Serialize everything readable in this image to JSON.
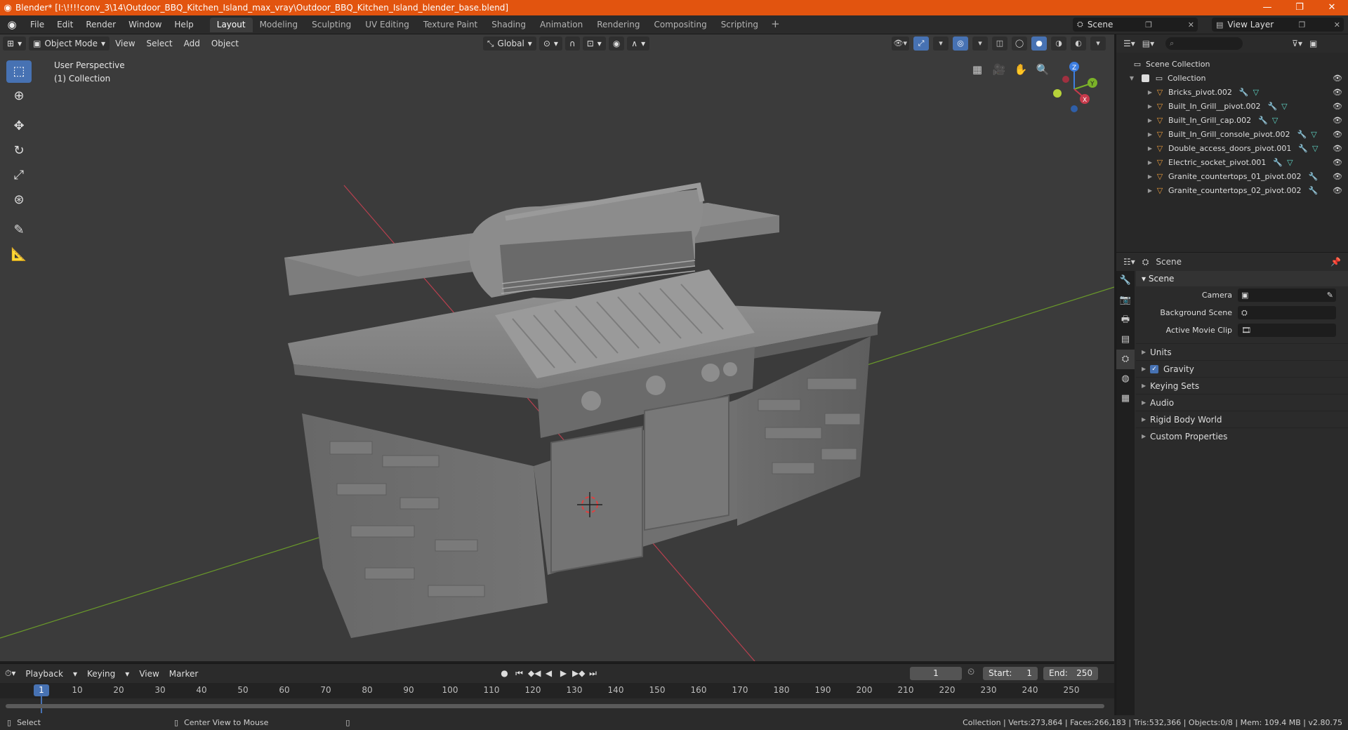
{
  "window": {
    "title": "Blender* [I:\\!!!!conv_3\\14\\Outdoor_BBQ_Kitchen_Island_max_vray\\Outdoor_BBQ_Kitchen_Island_blender_base.blend]",
    "minimize": "—",
    "maximize": "❐",
    "close": "✕"
  },
  "menu": [
    "File",
    "Edit",
    "Render",
    "Window",
    "Help"
  ],
  "workspaces": [
    "Layout",
    "Modeling",
    "Sculpting",
    "UV Editing",
    "Texture Paint",
    "Shading",
    "Animation",
    "Rendering",
    "Compositing",
    "Scripting"
  ],
  "active_workspace": "Layout",
  "scene_selector": "Scene",
  "view_layer": "View Layer",
  "viewport": {
    "mode": "Object Mode",
    "menus": [
      "View",
      "Select",
      "Add",
      "Object"
    ],
    "transform_orientation": "Global",
    "perspective_label": "User Perspective",
    "collection_label": "(1) Collection"
  },
  "outliner": {
    "root": "Scene Collection",
    "collection": "Collection",
    "objects": [
      {
        "name": "Bricks_pivot.002"
      },
      {
        "name": "Built_In_Grill__pivot.002"
      },
      {
        "name": "Built_In_Grill_cap.002"
      },
      {
        "name": "Built_In_Grill_console_pivot.002"
      },
      {
        "name": "Double_access_doors_pivot.001"
      },
      {
        "name": "Electric_socket_pivot.001"
      },
      {
        "name": "Granite_countertops_01_pivot.002"
      },
      {
        "name": "Granite_countertops_02_pivot.002"
      }
    ]
  },
  "properties": {
    "context": "Scene",
    "panel": "Scene",
    "fields": [
      {
        "label": "Camera",
        "value": ""
      },
      {
        "label": "Background Scene",
        "value": ""
      },
      {
        "label": "Active Movie Clip",
        "value": ""
      }
    ],
    "subpanels": [
      "Units",
      "Gravity",
      "Keying Sets",
      "Audio",
      "Rigid Body World",
      "Custom Properties"
    ]
  },
  "timeline": {
    "menus": [
      "Playback",
      "Keying",
      "View",
      "Marker"
    ],
    "current_frame": "1",
    "start_label": "Start:",
    "start": "1",
    "end_label": "End:",
    "end": "250",
    "ruler": [
      "1",
      "10",
      "20",
      "30",
      "40",
      "50",
      "60",
      "70",
      "80",
      "90",
      "100",
      "110",
      "120",
      "130",
      "140",
      "150",
      "160",
      "170",
      "180",
      "190",
      "200",
      "210",
      "220",
      "230",
      "240",
      "250"
    ]
  },
  "statusbar": {
    "select": "Select",
    "center": "Center View to Mouse",
    "stats": "Collection | Verts:273,864 | Faces:266,183 | Tris:532,366 | Objects:0/8 | Mem: 109.4 MB | v2.80.75"
  },
  "colors": {
    "title_bar": "#e2540f",
    "accent": "#4772b3",
    "x_axis": "#c73a4b",
    "y_axis": "#7bb228",
    "z_axis": "#3d7ee0"
  }
}
